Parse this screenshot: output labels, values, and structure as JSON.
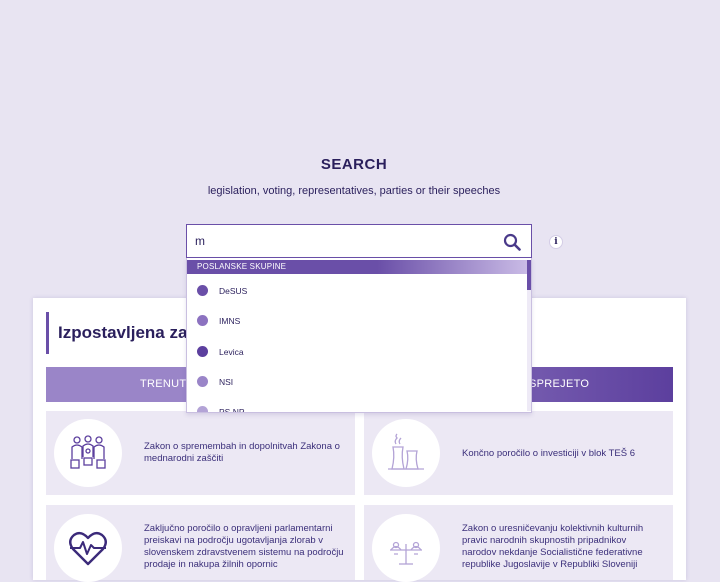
{
  "search": {
    "title": "SEARCH",
    "subtitle": "legislation, voting, representatives, parties or their speeches",
    "input_value": "m",
    "placeholder": ""
  },
  "dropdown": {
    "header": "POSLANSKE SKUPINE",
    "items": [
      {
        "label": "DeSUS",
        "color": "#6a4fa8"
      },
      {
        "label": "IMNS",
        "color": "#8c72c0"
      },
      {
        "label": "Levica",
        "color": "#5c3f9e"
      },
      {
        "label": "NSI",
        "color": "#9a85c8"
      },
      {
        "label": "PS NP",
        "color": "#b3a3d6"
      }
    ]
  },
  "section": {
    "heading": "Izpostavljena zakonodaja"
  },
  "tabs": [
    {
      "label": "TRENUTNO"
    },
    {
      "label": "SPREJETO"
    }
  ],
  "tiles": [
    {
      "text": "Zakon o spremembah in dopolnitvah Zakona o mednarodni zaščiti",
      "icon": "refugees-icon"
    },
    {
      "text": "Končno poročilo o investiciji v blok TEŠ 6",
      "icon": "power-plant-icon"
    },
    {
      "text": "Zaključno poročilo o opravljeni parlamentarni preiskavi na področju ugotavljanja zlorab v slovenskem zdravstvenem sistemu na področju prodaje in nakupa žilnih opornic",
      "icon": "heart-pulse-icon"
    },
    {
      "text": "Zakon o uresničevanju kolektivnih kulturnih pravic narodnih skupnostih pripadnikov narodov nekdanje Socialistične federativne republike Jugoslavije v Republiki Sloveniji",
      "icon": "scales-icon"
    }
  ],
  "colors": {
    "accent": "#6a4fa8",
    "background": "#e8e4f2",
    "text": "#2a1f5c"
  }
}
